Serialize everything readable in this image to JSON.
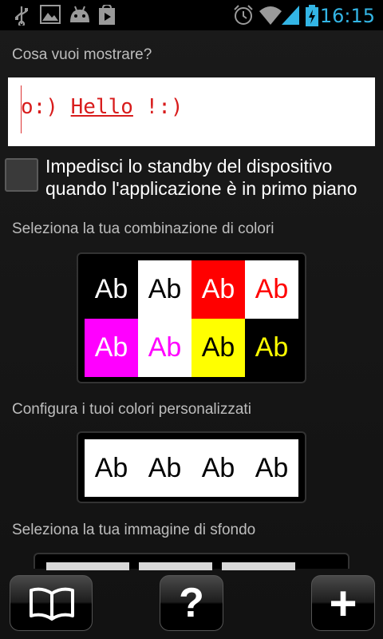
{
  "status_bar": {
    "time": "16:15",
    "icons": [
      "usb-icon",
      "image-icon",
      "android-icon",
      "play-store-icon",
      "alarm-icon",
      "wifi-icon",
      "signal-icon",
      "battery-charging-icon"
    ]
  },
  "section_display": {
    "title": "Cosa vuoi mostrare?",
    "preview_text_prefix": "o:) ",
    "preview_text_main": "Hello",
    "preview_text_suffix": " !:)"
  },
  "standby_checkbox": {
    "checked": false,
    "label": "Impedisci lo standby del dispositivo quando l'applicazione è in primo piano"
  },
  "section_palette": {
    "title": "Seleziona la tua combinazione di colori",
    "swatches": [
      {
        "text": "Ab",
        "bg": "#000000",
        "fg": "#ffffff"
      },
      {
        "text": "Ab",
        "bg": "#ffffff",
        "fg": "#000000"
      },
      {
        "text": "Ab",
        "bg": "#ff0000",
        "fg": "#ffffff"
      },
      {
        "text": "Ab",
        "bg": "#ffffff",
        "fg": "#ff0000"
      },
      {
        "text": "Ab",
        "bg": "#ff00ff",
        "fg": "#ffffff"
      },
      {
        "text": "Ab",
        "bg": "#ffffff",
        "fg": "#ff00ff"
      },
      {
        "text": "Ab",
        "bg": "#ffff00",
        "fg": "#000000"
      },
      {
        "text": "Ab",
        "bg": "#000000",
        "fg": "#ffff00"
      }
    ]
  },
  "section_custom": {
    "title": "Configura i tuoi colori personalizzati",
    "samples": [
      "Ab",
      "Ab",
      "Ab",
      "Ab"
    ]
  },
  "section_background": {
    "title": "Seleziona la tua immagine di sfondo"
  },
  "bottom_bar": {
    "buttons": [
      {
        "name": "book-icon"
      },
      {
        "name": "help-icon",
        "label": "?"
      },
      {
        "name": "add-icon",
        "label": "+"
      }
    ]
  }
}
